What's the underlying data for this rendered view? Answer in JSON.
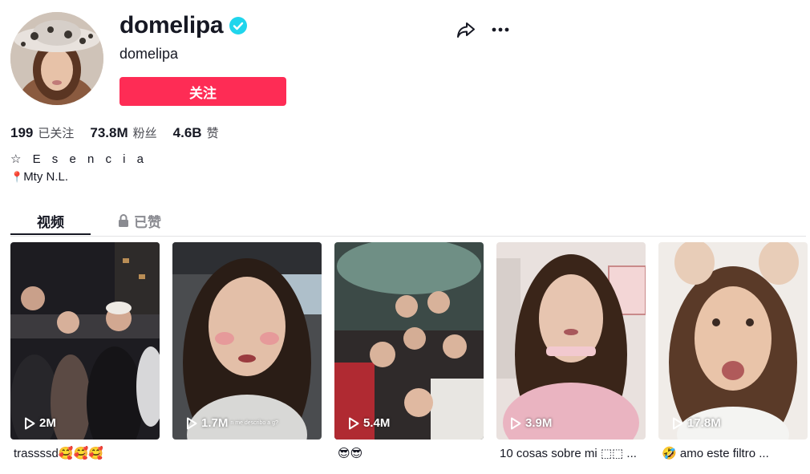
{
  "profile": {
    "username": "domelipa",
    "nickname": "domelipa",
    "verified": true,
    "follow_label": "关注",
    "bio_line1": "☆ E s e n c i a",
    "bio_line2": "Mty N.L.",
    "location_emoji": "📍"
  },
  "stats": [
    {
      "value": "199",
      "label": "已关注"
    },
    {
      "value": "73.8M",
      "label": "粉丝"
    },
    {
      "value": "4.6B",
      "label": "赞"
    }
  ],
  "tabs": {
    "videos": "视频",
    "liked": "已赞"
  },
  "videos": [
    {
      "views": "2M",
      "caption": "trassssd",
      "caption_emoji": "🥰🥰🥰"
    },
    {
      "views": "1.7M",
      "caption": "",
      "overlay_text": "n me describo a g?"
    },
    {
      "views": "5.4M",
      "caption": "",
      "caption_emoji": "😎😎"
    },
    {
      "views": "3.9M",
      "caption": "10 cosas sobre mi ⬚⬚ ..."
    },
    {
      "views": "17.8M",
      "caption": "amo este filtro ...",
      "caption_emoji": "🤣"
    }
  ],
  "colors": {
    "accent": "#fe2c55",
    "verified": "#20d5ec",
    "text": "#161823",
    "muted": "#8a8b91"
  }
}
